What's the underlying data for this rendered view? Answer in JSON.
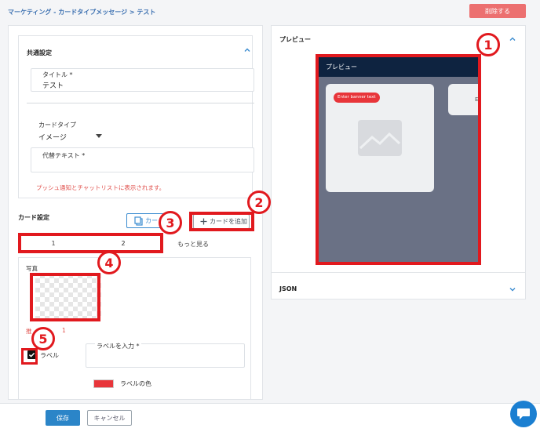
{
  "breadcrumb": "マーケティング - カードタイプメッセージ > テスト",
  "header": {
    "delete_label": "削除する"
  },
  "common_settings": {
    "title": "共通設定",
    "title_label": "タイトル *",
    "title_value": "テスト",
    "card_type_label": "カードタイプ",
    "card_type_value": "イメージ",
    "alt_text_label": "代替テキスト *",
    "alt_text_value": "",
    "push_note": "プッシュ通知とチャットリストに表示されます。"
  },
  "card_settings": {
    "title": "カード設定",
    "copy_label": "カー",
    "add_label": "カードを追加",
    "tabs": [
      "1",
      "2"
    ],
    "see_more": "もっと見る",
    "photo_label": "写真",
    "recommend_note": "推",
    "recommend_note_tail": "1",
    "label_checkbox": "ラベル",
    "label_input_label": "ラベルを入力 *",
    "label_input_value": "",
    "label_color_label": "ラベルの色",
    "label_color": "#e8353a"
  },
  "preview": {
    "title": "プレビュー",
    "screen_header": "プレビュー",
    "banner_text": "Enter banner text",
    "second_card_text": "E",
    "json_label": "JSON"
  },
  "footer": {
    "save_label": "保存",
    "cancel_label": "キャンセル"
  },
  "annotations": [
    "1",
    "2",
    "3",
    "4",
    "5"
  ],
  "colors": {
    "accent": "#2b85c8",
    "danger": "#ec7070",
    "annotation": "#e1191e",
    "preview_bg": "#6a7185",
    "preview_header": "#0e2340"
  }
}
